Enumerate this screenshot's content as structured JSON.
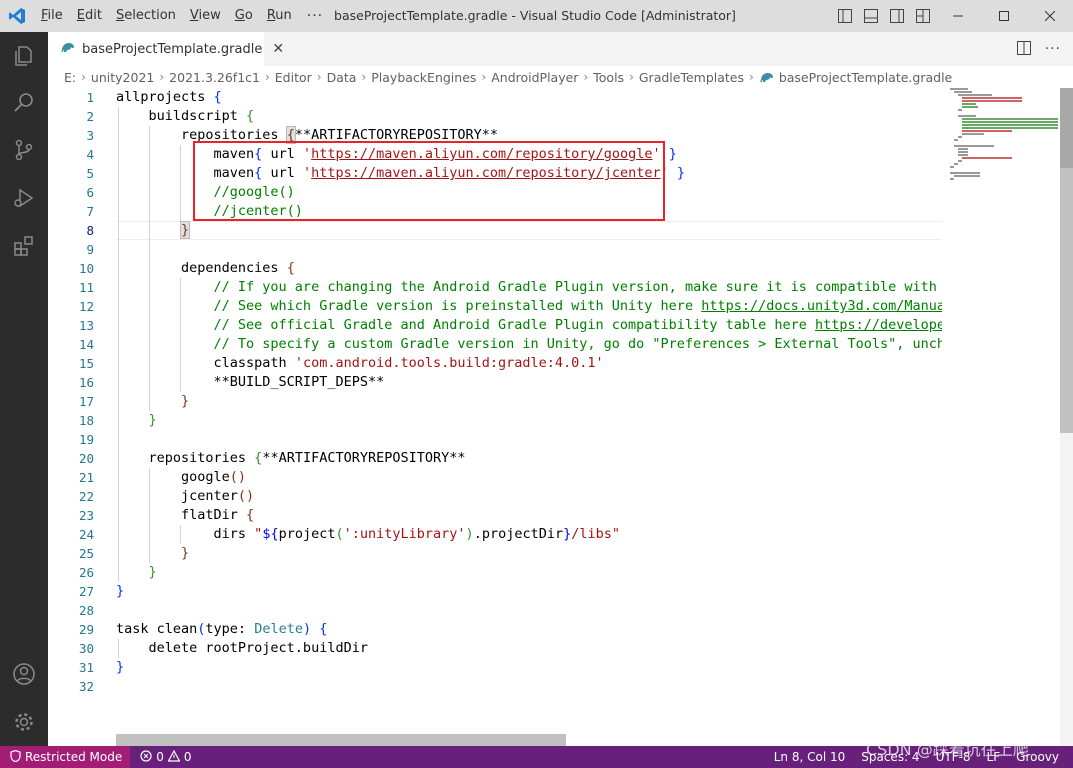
{
  "window": {
    "title": "baseProjectTemplate.gradle - Visual Studio Code [Administrator]",
    "menu": [
      {
        "u": "F",
        "rest": "ile"
      },
      {
        "u": "E",
        "rest": "dit"
      },
      {
        "u": "S",
        "rest": "election"
      },
      {
        "u": "V",
        "rest": "iew"
      },
      {
        "u": "G",
        "rest": "o"
      },
      {
        "u": "R",
        "rest": "un"
      }
    ],
    "menu_more": "···"
  },
  "tab": {
    "name": "baseProjectTemplate.gradle",
    "close": "✕"
  },
  "breadcrumb": [
    "E:",
    "unity2021",
    "2021.3.26f1c1",
    "Editor",
    "Data",
    "PlaybackEngines",
    "AndroidPlayer",
    "Tools",
    "GradleTemplates",
    "baseProjectTemplate.gradle"
  ],
  "editor": {
    "line_numbers": [
      "1",
      "2",
      "3",
      "4",
      "5",
      "6",
      "7",
      "8",
      "9",
      "10",
      "11",
      "12",
      "13",
      "14",
      "15",
      "16",
      "17",
      "18",
      "19",
      "20",
      "21",
      "22",
      "23",
      "24",
      "25",
      "26",
      "27",
      "28",
      "29",
      "30",
      "31",
      "32"
    ],
    "active_line": "8"
  },
  "status": {
    "restricted": "Restricted Mode",
    "errors": "0",
    "warnings": "0",
    "position": "Ln 8, Col 10",
    "spaces": "Spaces: 4",
    "encoding": "UTF-8",
    "eol": "LF",
    "language": "Groovy"
  },
  "watermark": "CSDN @踩着坑往上爬",
  "colors": {
    "statusbar": "#68217a",
    "restricted": "#a21e76",
    "activitybar": "#2c2c2c",
    "highlight_box": "#e8232a"
  }
}
